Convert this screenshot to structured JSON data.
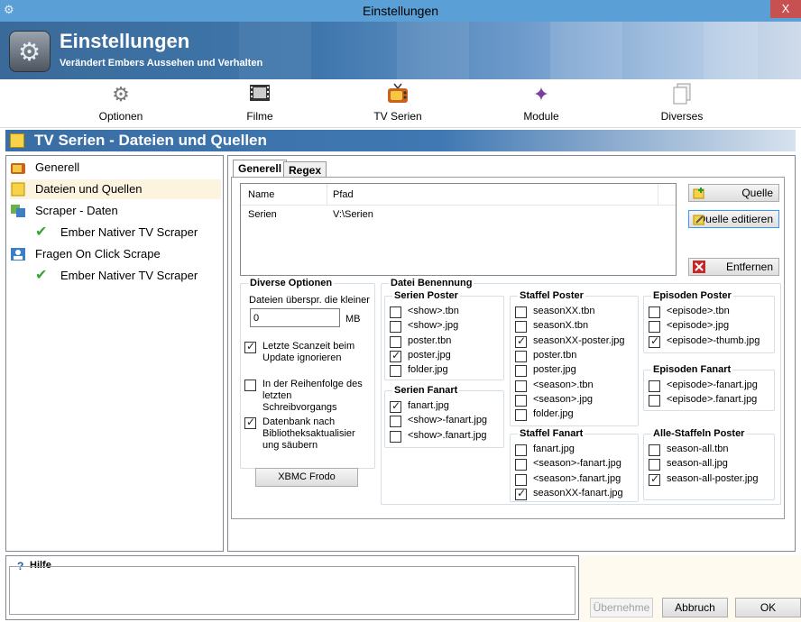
{
  "window": {
    "title": "Einstellungen",
    "close": "X"
  },
  "banner": {
    "title": "Einstellungen",
    "subtitle": "Verändert Embers Aussehen und Verhalten"
  },
  "toolbar": [
    {
      "label": "Optionen",
      "icon": "gear-icon"
    },
    {
      "label": "Filme",
      "icon": "film-icon"
    },
    {
      "label": "TV Serien",
      "icon": "tv-icon"
    },
    {
      "label": "Module",
      "icon": "puzzle-icon"
    },
    {
      "label": "Diverses",
      "icon": "document-icon"
    }
  ],
  "section": {
    "title": "TV Serien - Dateien und Quellen"
  },
  "tree": [
    {
      "label": "Generell"
    },
    {
      "label": "Dateien und Quellen"
    },
    {
      "label": "Scraper - Daten"
    },
    {
      "label": "Ember Nativer TV Scraper"
    },
    {
      "label": "Fragen On Click Scrape"
    },
    {
      "label": "Ember Nativer TV Scraper"
    }
  ],
  "tabs": [
    "Generell",
    "Regex"
  ],
  "sources": {
    "headers": [
      "Name",
      "Pfad"
    ],
    "rows": [
      {
        "name": "Serien",
        "path": "V:\\Serien"
      }
    ]
  },
  "buttons": {
    "add": "Quelle",
    "edit": "Quelle editieren",
    "remove": "Entfernen",
    "xbmc": "XBMC Frodo"
  },
  "diverse": {
    "title": "Diverse Optionen",
    "skip_label": "Dateien überspr. die kleiner",
    "skip_value": "0",
    "unit": "MB",
    "opt1": "Letzte Scanzeit beim Update ignorieren",
    "opt1_checked": true,
    "opt2": "In der Reihenfolge des letzten Schreibvorgangs",
    "opt2_checked": false,
    "opt3": "Datenbank nach Bibliotheksaktualisier ung säubern",
    "opt3_checked": true
  },
  "naming": {
    "title": "Datei Benennung",
    "serien_poster": {
      "title": "Serien Poster",
      "items": [
        {
          "label": "<show>.tbn",
          "checked": false
        },
        {
          "label": "<show>.jpg",
          "checked": false
        },
        {
          "label": "poster.tbn",
          "checked": false
        },
        {
          "label": "poster.jpg",
          "checked": true
        },
        {
          "label": "folder.jpg",
          "checked": false
        }
      ]
    },
    "serien_fanart": {
      "title": "Serien Fanart",
      "items": [
        {
          "label": "fanart.jpg",
          "checked": true
        },
        {
          "label": "<show>-fanart.jpg",
          "checked": false
        },
        {
          "label": "<show>.fanart.jpg",
          "checked": false
        }
      ]
    },
    "staffel_poster": {
      "title": "Staffel Poster",
      "items": [
        {
          "label": "seasonXX.tbn",
          "checked": false
        },
        {
          "label": "seasonX.tbn",
          "checked": false
        },
        {
          "label": "seasonXX-poster.jpg",
          "checked": true
        },
        {
          "label": "poster.tbn",
          "checked": false
        },
        {
          "label": "poster.jpg",
          "checked": false
        },
        {
          "label": "<season>.tbn",
          "checked": false
        },
        {
          "label": "<season>.jpg",
          "checked": false
        },
        {
          "label": "folder.jpg",
          "checked": false
        }
      ]
    },
    "staffel_fanart": {
      "title": "Staffel Fanart",
      "items": [
        {
          "label": "fanart.jpg",
          "checked": false
        },
        {
          "label": "<season>-fanart.jpg",
          "checked": false
        },
        {
          "label": "<season>.fanart.jpg",
          "checked": false
        },
        {
          "label": "seasonXX-fanart.jpg",
          "checked": true
        }
      ]
    },
    "episoden_poster": {
      "title": "Episoden Poster",
      "items": [
        {
          "label": "<episode>.tbn",
          "checked": false
        },
        {
          "label": "<episode>.jpg",
          "checked": false
        },
        {
          "label": "<episode>-thumb.jpg",
          "checked": true
        }
      ]
    },
    "episoden_fanart": {
      "title": "Episoden Fanart",
      "items": [
        {
          "label": "<episode>-fanart.jpg",
          "checked": false
        },
        {
          "label": "<episode>.fanart.jpg",
          "checked": false
        }
      ]
    },
    "alle_staffeln": {
      "title": "Alle-Staffeln Poster",
      "items": [
        {
          "label": "season-all.tbn",
          "checked": false
        },
        {
          "label": "season-all.jpg",
          "checked": false
        },
        {
          "label": "season-all-poster.jpg",
          "checked": true
        }
      ]
    }
  },
  "help": {
    "title": "Hilfe"
  },
  "footer": {
    "apply": "Übernehme",
    "cancel": "Abbruch",
    "ok": "OK"
  }
}
